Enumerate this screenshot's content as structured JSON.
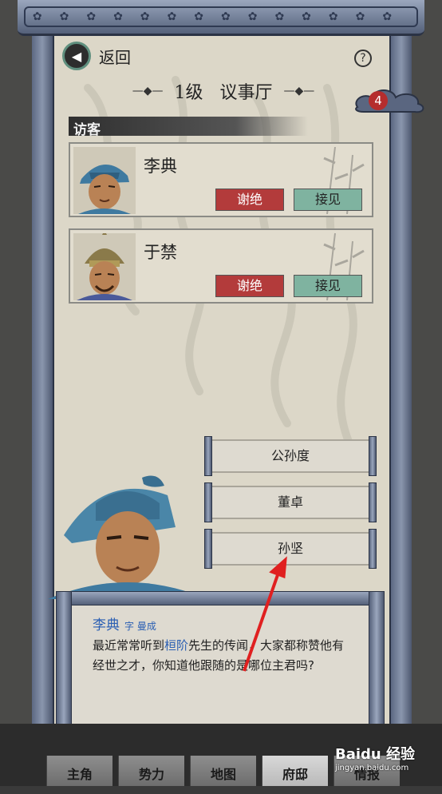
{
  "header": {
    "back_label": "返回",
    "help_symbol": "?",
    "title_level": "1级",
    "title_name": "议事厅",
    "badge_count": "4"
  },
  "visitors": {
    "section_label": "访客",
    "items": [
      {
        "name": "李典",
        "reject_label": "谢绝",
        "accept_label": "接见"
      },
      {
        "name": "于禁",
        "reject_label": "谢绝",
        "accept_label": "接见"
      }
    ]
  },
  "choices": [
    "公孙度",
    "董卓",
    "孙坚"
  ],
  "dialog": {
    "speaker": "李典",
    "style_name": "字 曼成",
    "text_before": "最近常常听到",
    "text_highlight": "桓阶",
    "text_after": "先生的传闻，大家都称赞他有经世之才，你知道他跟随的是哪位主君吗?"
  },
  "nav": {
    "tabs": [
      "主角",
      "势力",
      "地图",
      "府邸",
      "情报"
    ],
    "active_index": 3
  },
  "watermark": {
    "main": "Baidu 经验",
    "sub": "jingyan.baidu.com"
  },
  "colors": {
    "paper": "#dcd7c8",
    "reject": "#b33b3b",
    "accept": "#7fb3a0",
    "highlight": "#2a5fb3",
    "arrow": "#e02020"
  }
}
